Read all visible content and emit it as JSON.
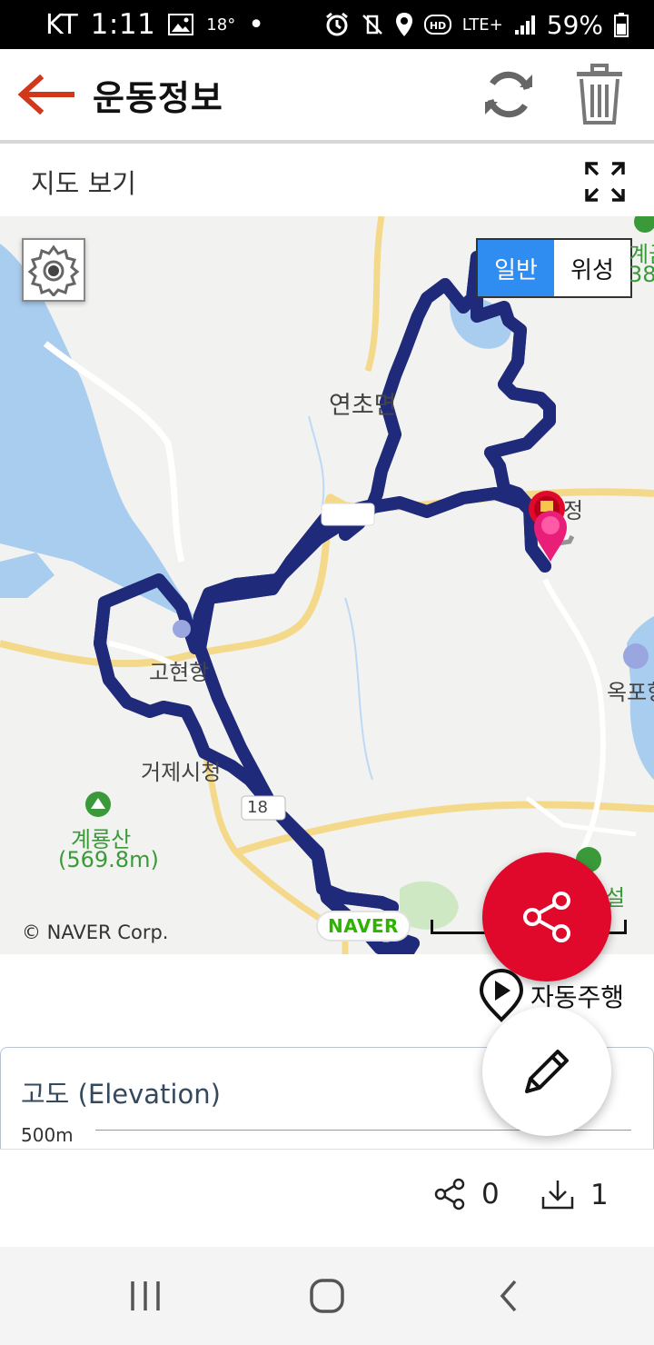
{
  "status_bar": {
    "carrier": "KT",
    "time": "1:11",
    "temperature": "18°",
    "network": "LTE+",
    "battery": "59%"
  },
  "header": {
    "title": "운동정보"
  },
  "map_section": {
    "label": "지도 보기",
    "map_type": {
      "normal": "일반",
      "satellite": "위성",
      "selected": "일반"
    },
    "places": [
      "연초면",
      "고현항",
      "거제시청",
      "옥포항",
      "계룡산",
      "(569.8m)",
      "정"
    ],
    "partial_labels": [
      "계금",
      "38.",
      "설"
    ],
    "road_number": "18",
    "copyright": "© NAVER Corp.",
    "brand": "NAVER",
    "colors": {
      "route_fill": "#8a8a8a",
      "route_outline": "#1f2a7a",
      "water": "#a9cdef",
      "road": "#f5d98a"
    }
  },
  "actions": {
    "autoplay_label": "자동주행"
  },
  "elevation": {
    "title": "고도 (Elevation)",
    "y_label": "500m"
  },
  "stats": {
    "shares": "0",
    "downloads": "1"
  },
  "icons": [
    "back-arrow-icon",
    "refresh-icon",
    "trash-icon",
    "expand-icon",
    "gear-icon",
    "share-icon",
    "play-pin-icon",
    "pencil-icon",
    "download-icon",
    "recents-icon",
    "home-icon",
    "back-nav-icon"
  ]
}
